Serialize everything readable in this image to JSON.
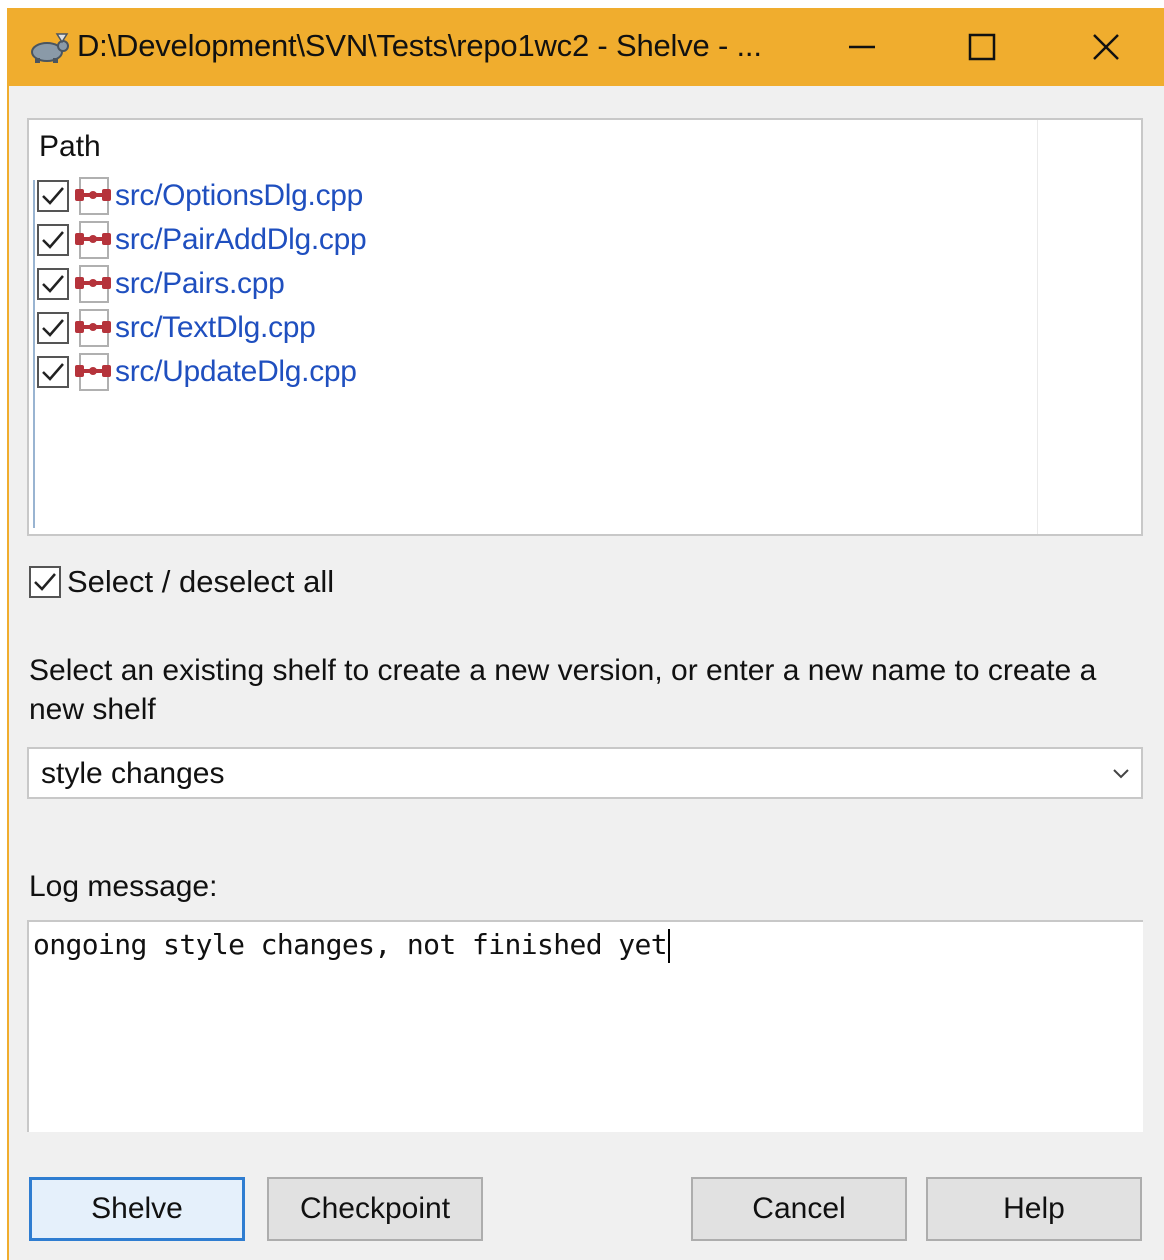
{
  "window": {
    "title": "D:\\Development\\SVN\\Tests\\repo1wc2 - Shelve - ...",
    "accent_color": "#f0ad2e"
  },
  "file_list": {
    "column_header": "Path",
    "items": [
      {
        "path": "src/OptionsDlg.cpp",
        "checked": true,
        "icon": "modified-file-icon"
      },
      {
        "path": "src/PairAddDlg.cpp",
        "checked": true,
        "icon": "modified-file-icon"
      },
      {
        "path": "src/Pairs.cpp",
        "checked": true,
        "icon": "modified-file-icon"
      },
      {
        "path": "src/TextDlg.cpp",
        "checked": true,
        "icon": "modified-file-icon"
      },
      {
        "path": "src/UpdateDlg.cpp",
        "checked": true,
        "icon": "modified-file-icon"
      }
    ]
  },
  "select_all": {
    "label": "Select / deselect all",
    "checked": true
  },
  "shelf": {
    "description": "Select an existing shelf to create a new version, or enter a new name to create a new shelf",
    "selected": "style changes"
  },
  "log": {
    "label": "Log message:",
    "value": "ongoing style changes, not finished yet"
  },
  "buttons": {
    "shelve": "Shelve",
    "checkpoint": "Checkpoint",
    "cancel": "Cancel",
    "help": "Help"
  }
}
